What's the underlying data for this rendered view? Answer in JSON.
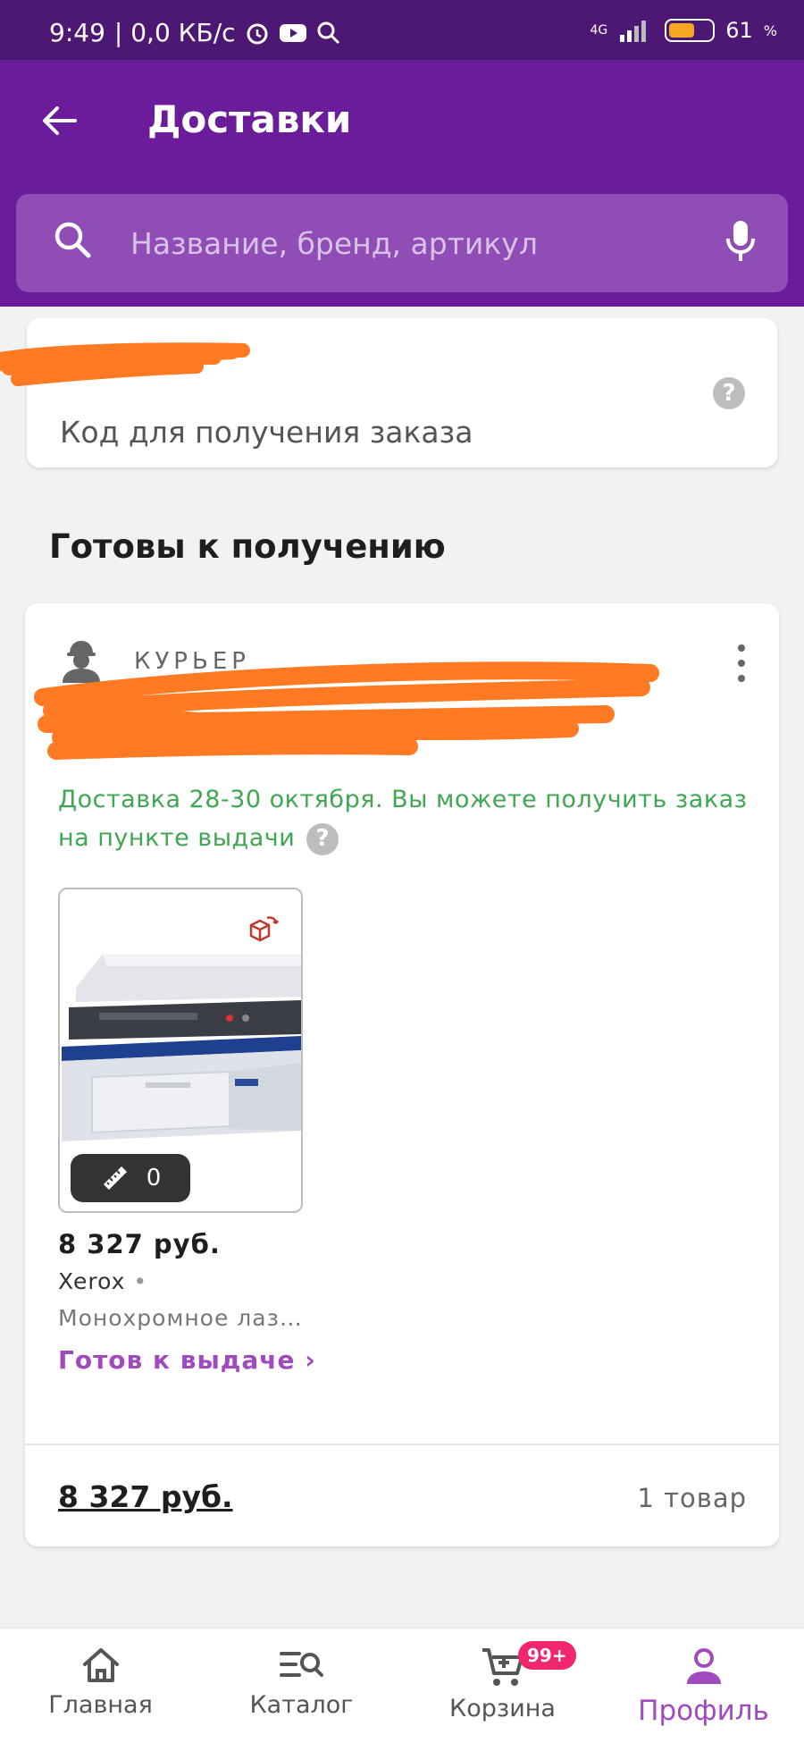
{
  "statusbar": {
    "time": "9:49",
    "speed": "| 0,0 КБ/с",
    "network": "4G",
    "battery": "61",
    "battery_unit": "%"
  },
  "header": {
    "title": "Доставки"
  },
  "search": {
    "placeholder": "Название, бренд, артикул"
  },
  "code_card": {
    "label": "Код для получения заказа",
    "help": "?"
  },
  "section": {
    "title": "Готовы к получению"
  },
  "order": {
    "delivery_type": "КУРЬЕР",
    "delivery_note": "Доставка 28-30 октября. Вы можете получить заказ на пункте выдачи",
    "help": "?",
    "product": {
      "size_count": "0",
      "price": "8 327 руб.",
      "brand": "Xerox",
      "brand_sep": "•",
      "name": "Монохромное лаз…",
      "status": "Готов к выдаче ›"
    },
    "total": "8 327 руб.",
    "count": "1 товар"
  },
  "nav": {
    "items": [
      {
        "label": "Главная",
        "icon": "home-icon"
      },
      {
        "label": "Каталог",
        "icon": "catalog-search-icon"
      },
      {
        "label": "Корзина",
        "icon": "cart-icon",
        "badge": "99+"
      },
      {
        "label": "Профиль",
        "icon": "profile-icon",
        "active": true
      }
    ]
  },
  "colors": {
    "statusbar": "#4c1874",
    "appbar": "#6b1c9a",
    "accent": "#a04abf",
    "success": "#3fa652",
    "badge": "#f2266d",
    "redaction": "#ff7a22"
  }
}
